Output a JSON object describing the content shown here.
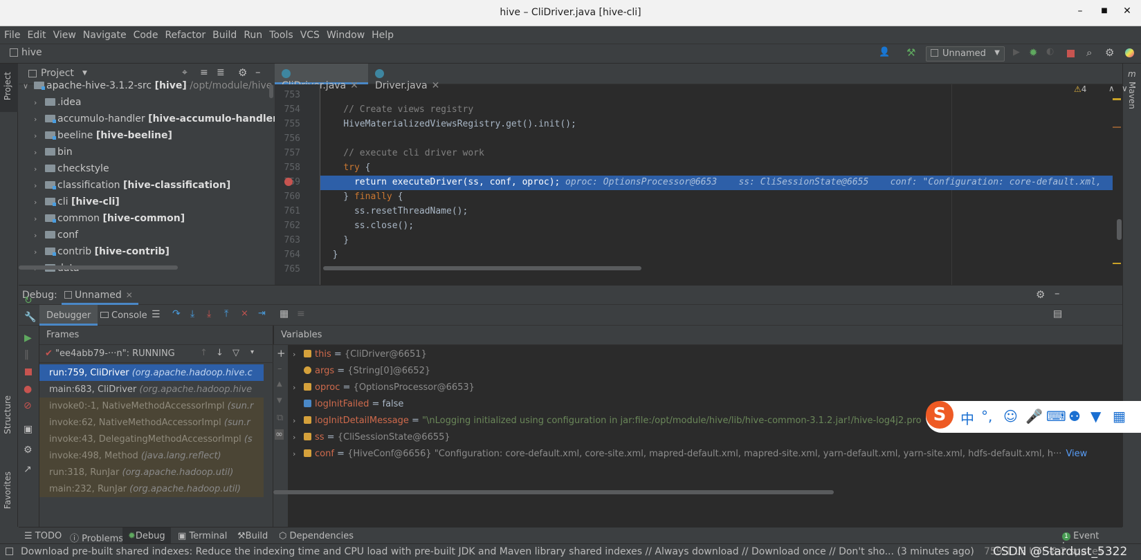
{
  "window": {
    "title": "hive – CliDriver.java [hive-cli]",
    "min": "–",
    "max": "■",
    "close": "✕"
  },
  "menu": [
    "File",
    "Edit",
    "View",
    "Navigate",
    "Code",
    "Refactor",
    "Build",
    "Run",
    "Tools",
    "VCS",
    "Window",
    "Help"
  ],
  "nav": {
    "breadcrumb": "hive",
    "run_config": "Unnamed"
  },
  "project_panel": {
    "title": "Project",
    "tree": [
      {
        "name": "apache-hive-3.1.2-src",
        "module": "[hive]",
        "path": "/opt/module/hive",
        "expanded": true,
        "level": 0
      },
      {
        "name": ".idea",
        "module": "",
        "level": 1
      },
      {
        "name": "accumulo-handler",
        "module": "[hive-accumulo-handler]",
        "level": 1
      },
      {
        "name": "beeline",
        "module": "[hive-beeline]",
        "level": 1
      },
      {
        "name": "bin",
        "module": "",
        "level": 1
      },
      {
        "name": "checkstyle",
        "module": "",
        "level": 1
      },
      {
        "name": "classification",
        "module": "[hive-classification]",
        "level": 1
      },
      {
        "name": "cli",
        "module": "[hive-cli]",
        "level": 1
      },
      {
        "name": "common",
        "module": "[hive-common]",
        "level": 1
      },
      {
        "name": "conf",
        "module": "",
        "level": 1
      },
      {
        "name": "contrib",
        "module": "[hive-contrib]",
        "level": 1
      },
      {
        "name": "data",
        "module": "",
        "level": 1
      }
    ]
  },
  "editor": {
    "tabs": [
      {
        "label": "CliDriver.java",
        "active": true
      },
      {
        "label": "Driver.java",
        "active": false
      }
    ],
    "warnings": "4",
    "lines": [
      {
        "num": "753",
        "code": ""
      },
      {
        "num": "754",
        "code": "    // Create views registry"
      },
      {
        "num": "755",
        "code": "    HiveMaterializedViewsRegistry.get().init();"
      },
      {
        "num": "756",
        "code": ""
      },
      {
        "num": "757",
        "code": "    // execute cli driver work"
      },
      {
        "num": "758",
        "code": "    try {"
      },
      {
        "num": "759",
        "code": "      return executeDriver(ss, conf, oproc);"
      },
      {
        "num": "760",
        "code": "    } finally {"
      },
      {
        "num": "761",
        "code": "      ss.resetThreadName();"
      },
      {
        "num": "762",
        "code": "      ss.close();"
      },
      {
        "num": "763",
        "code": "    }"
      },
      {
        "num": "764",
        "code": "  }"
      },
      {
        "num": "765",
        "code": ""
      }
    ],
    "inline_debug": "oproc: OptionsProcessor@6653    ss: CliSessionState@6655    conf: \"Configuration: core-default.xml,"
  },
  "debug": {
    "label": "Debug:",
    "session": "Unnamed",
    "tabs": [
      "Debugger",
      "Console"
    ],
    "frames_title": "Frames",
    "thread": "\"ee4abb79-···n\": RUNNING",
    "frames": [
      {
        "method": "run:759, CliDriver",
        "pkg": "(org.apache.hadoop.hive.c",
        "type": "sel"
      },
      {
        "method": "main:683, CliDriver",
        "pkg": "(org.apache.hadoop.hive",
        "type": "normal"
      },
      {
        "method": "invoke0:-1, NativeMethodAccessorImpl",
        "pkg": "(sun.r",
        "type": "lib"
      },
      {
        "method": "invoke:62, NativeMethodAccessorImpl",
        "pkg": "(sun.r",
        "type": "lib"
      },
      {
        "method": "invoke:43, DelegatingMethodAccessorImpl",
        "pkg": "(s",
        "type": "lib"
      },
      {
        "method": "invoke:498, Method",
        "pkg": "(java.lang.reflect)",
        "type": "lib"
      },
      {
        "method": "run:318, RunJar",
        "pkg": "(org.apache.hadoop.util)",
        "type": "lib"
      },
      {
        "method": "main:232, RunJar",
        "pkg": "(org.apache.hadoop.util)",
        "type": "lib"
      }
    ],
    "variables_title": "Variables",
    "variables": [
      {
        "name": "this",
        "eq": " = ",
        "value": "{CliDriver@6651}",
        "expandable": true
      },
      {
        "name": "args",
        "eq": " = ",
        "value": "{String[0]@6652}",
        "expandable": false
      },
      {
        "name": "oproc",
        "eq": " = ",
        "value": "{OptionsProcessor@6653}",
        "expandable": true
      },
      {
        "name": "logInitFailed",
        "eq": " = ",
        "value": "false",
        "expandable": false
      },
      {
        "name": "logInitDetailMessage",
        "eq": " = ",
        "value": "\"\\nLogging initialized using configuration in jar:file:/opt/module/hive/lib/hive-common-3.1.2.jar!/hive-log4j2.pro",
        "expandable": true
      },
      {
        "name": "ss",
        "eq": " = ",
        "value": "{CliSessionState@6655}",
        "expandable": true
      },
      {
        "name": "conf",
        "eq": " = ",
        "value": "{HiveConf@6656} \"Configuration: core-default.xml, core-site.xml, mapred-default.xml, mapred-site.xml, yarn-default.xml, yarn-site.xml, hdfs-default.xml, h···",
        "expandable": true,
        "link": "View"
      }
    ]
  },
  "bottom_tabs": [
    "TODO",
    "Problems",
    "Debug",
    "Terminal",
    "Build",
    "Dependencies"
  ],
  "event_log": {
    "count": "1",
    "label": "Event Log"
  },
  "status": {
    "message": "Download pre-built shared indexes: Reduce the indexing time and CPU load with pre-built JDK and Maven library shared indexes // Always download // Download once // Don't sho... (3 minutes ago)",
    "position": "759:1  LF  UTF-8  2 spaces",
    "watermark": "CSDN @Stardust_5322"
  },
  "side_tabs": {
    "project": "Project",
    "structure": "Structure",
    "favorites": "Favorites",
    "maven": "Maven"
  },
  "ime": {
    "logo": "S",
    "zh": "中",
    "punct": "°,"
  }
}
